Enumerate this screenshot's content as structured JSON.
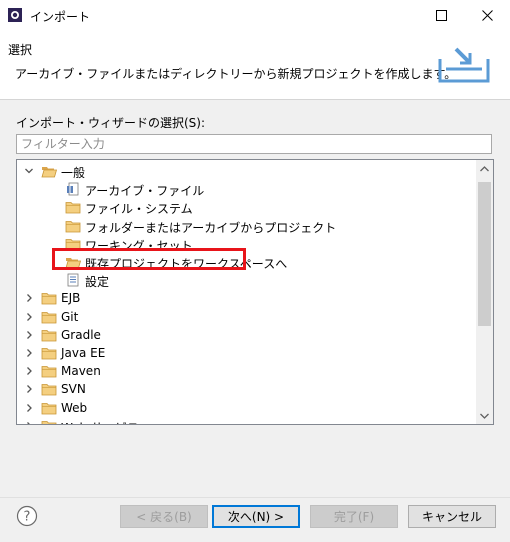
{
  "window": {
    "title": "インポート"
  },
  "header": {
    "title": "選択",
    "description": "アーカイブ・ファイルまたはディレクトリーから新規プロジェクトを作成します。"
  },
  "wizard": {
    "label": "インポート・ウィザードの選択(S):",
    "filter_placeholder": "フィルター入力",
    "tree": [
      {
        "label": "一般",
        "level": 0,
        "expanded": true,
        "icon": "folder-open-icon"
      },
      {
        "label": "アーカイブ・ファイル",
        "level": 1,
        "icon": "archive-file-icon"
      },
      {
        "label": "ファイル・システム",
        "level": 1,
        "icon": "folder-icon"
      },
      {
        "label": "フォルダーまたはアーカイブからプロジェクト",
        "level": 1,
        "icon": "folder-icon"
      },
      {
        "label": "ワーキング・セット",
        "level": 1,
        "icon": "folder-icon"
      },
      {
        "label": "既存プロジェクトをワークスペースへ",
        "level": 1,
        "icon": "folder-open-icon",
        "selected": true
      },
      {
        "label": "設定",
        "level": 1,
        "icon": "settings-doc-icon"
      },
      {
        "label": "EJB",
        "level": 0,
        "expanded": false,
        "icon": "folder-icon"
      },
      {
        "label": "Git",
        "level": 0,
        "expanded": false,
        "icon": "folder-icon"
      },
      {
        "label": "Gradle",
        "level": 0,
        "expanded": false,
        "icon": "folder-icon"
      },
      {
        "label": "Java EE",
        "level": 0,
        "expanded": false,
        "icon": "folder-icon"
      },
      {
        "label": "Maven",
        "level": 0,
        "expanded": false,
        "icon": "folder-icon"
      },
      {
        "label": "SVN",
        "level": 0,
        "expanded": false,
        "icon": "folder-icon"
      },
      {
        "label": "Web",
        "level": 0,
        "expanded": false,
        "icon": "folder-icon"
      },
      {
        "label": "Web サービス",
        "level": 0,
        "expanded": false,
        "icon": "folder-icon"
      }
    ]
  },
  "buttons": {
    "back": "< 戻る(B)",
    "next": "次へ(N) >",
    "finish": "完了(F)",
    "cancel": "キャンセル"
  },
  "colors": {
    "highlight": "#e8141a",
    "folder": "#e8b04a"
  }
}
